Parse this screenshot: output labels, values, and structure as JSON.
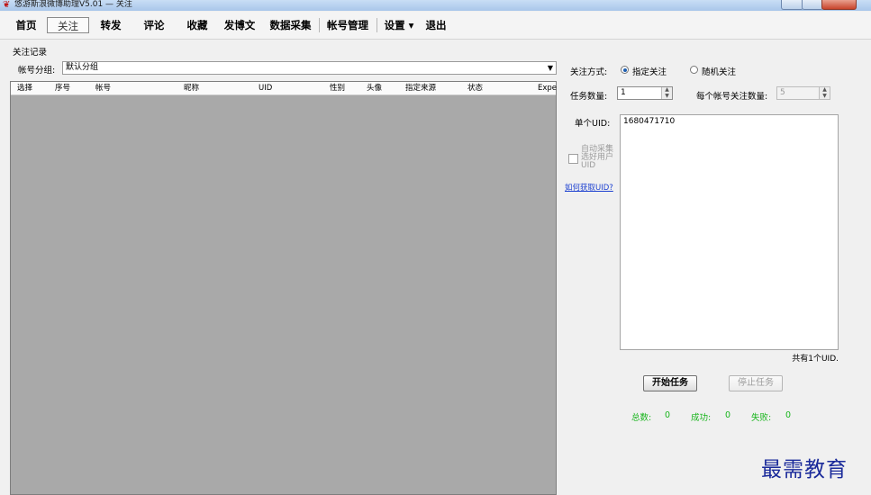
{
  "window": {
    "title": "悠游斯浪微博助理V5.01 — 关注"
  },
  "menu": {
    "items": [
      {
        "id": "home",
        "label": "首页"
      },
      {
        "id": "follow",
        "label": "关注"
      },
      {
        "id": "repost",
        "label": "转发"
      },
      {
        "id": "comment",
        "label": "评论"
      },
      {
        "id": "favorite",
        "label": "收藏"
      },
      {
        "id": "post",
        "label": "发博文"
      },
      {
        "id": "collect",
        "label": "数据采集"
      },
      {
        "id": "accounts",
        "label": "帐号管理"
      },
      {
        "id": "settings",
        "label": "设置 ▾"
      },
      {
        "id": "exit",
        "label": "退出"
      }
    ]
  },
  "left": {
    "group_title": "关注记录",
    "account_label": "帐号分组:",
    "account_value": "默认分组",
    "columns": [
      "选择",
      "序号",
      "帐号",
      "昵称",
      "UID",
      "性别",
      "头像",
      "指定来源",
      "状态",
      "Expe"
    ]
  },
  "right": {
    "mode_label": "关注方式:",
    "mode_options": [
      "指定关注",
      "随机关注"
    ],
    "mode_selected": "指定关注",
    "task_count_label": "任务数量:",
    "task_count_value": "1",
    "per_account_label": "每个帐号关注数量:",
    "per_account_value": "5",
    "single_uid_label": "单个UID:",
    "uid_text": "1680471710",
    "auto_collect_label": "自动采集选好用户UID",
    "help_link": "如何获取UID?",
    "uid_count": "共有1个UID.",
    "start_button": "开始任务",
    "stop_button": "停止任务",
    "stats": {
      "total_label": "总数:",
      "total": "0",
      "success_label": "成功:",
      "success": "0",
      "fail_label": "失败:",
      "fail": "0"
    }
  },
  "watermark": "最需教育"
}
